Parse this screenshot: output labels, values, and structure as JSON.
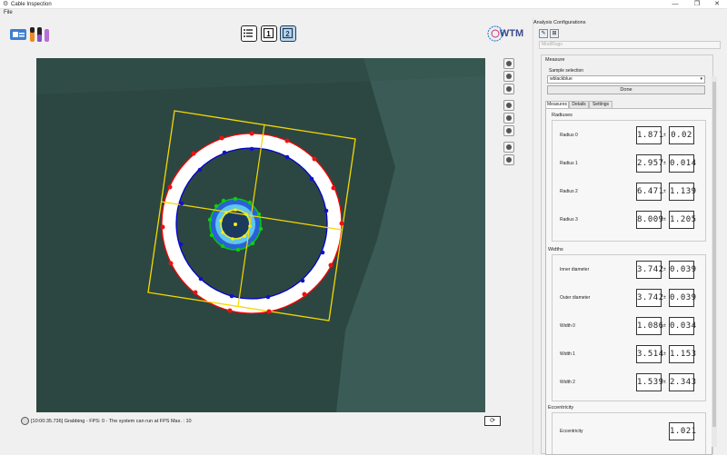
{
  "window": {
    "title": "Cable Inspection",
    "minimize": "—",
    "maximize": "❐",
    "close": "✕"
  },
  "menu": {
    "file": "File"
  },
  "status": {
    "text": "[10:00:35.736] Grabbing - FPS: 0 - The system can run at FPS Max. : 10"
  },
  "panel": {
    "title": "Analysis Configurations",
    "config_combo": "Mod/Rugo",
    "measure_title": "Measure",
    "sample_label": "Sample selection",
    "sample_value": "wblackblue",
    "done_label": "Done",
    "tabs": [
      "Measures",
      "Details",
      "Settings"
    ],
    "groups": {
      "radiuses": {
        "title": "Radiuses",
        "rows": [
          {
            "label": "Radius 0",
            "value": "1.871",
            "tol": "0.02"
          },
          {
            "label": "Radius 1",
            "value": "2.957",
            "tol": "0.014"
          },
          {
            "label": "Radius 2",
            "value": "6.471",
            "tol": "1.139"
          },
          {
            "label": "Radius 3",
            "value": "8.009",
            "tol": "1.205"
          }
        ]
      },
      "widths": {
        "title": "Widths",
        "rows": [
          {
            "label": "Inner diameter",
            "value": "3.742",
            "tol": "0.039"
          },
          {
            "label": "Outer diameter",
            "value": "3.742",
            "tol": "0.039"
          },
          {
            "label": "Width 0",
            "value": "1.086",
            "tol": "0.034"
          },
          {
            "label": "Width 1",
            "value": "3.514",
            "tol": "1.153"
          },
          {
            "label": "Width 2",
            "value": "1.539",
            "tol": "2.343"
          }
        ]
      },
      "eccentricity": {
        "title": "Eccentricity",
        "rows": [
          {
            "label": "Eccentricity",
            "value": "1.021"
          }
        ]
      }
    },
    "pm_symbol": "±"
  },
  "logos": {
    "wtm": "WTM"
  },
  "colors": {
    "outer_ring": "#ff0000",
    "inner_ring": "#0000cc",
    "core": "#00cc00",
    "center": "#ffee00",
    "box": "#f5d800"
  }
}
